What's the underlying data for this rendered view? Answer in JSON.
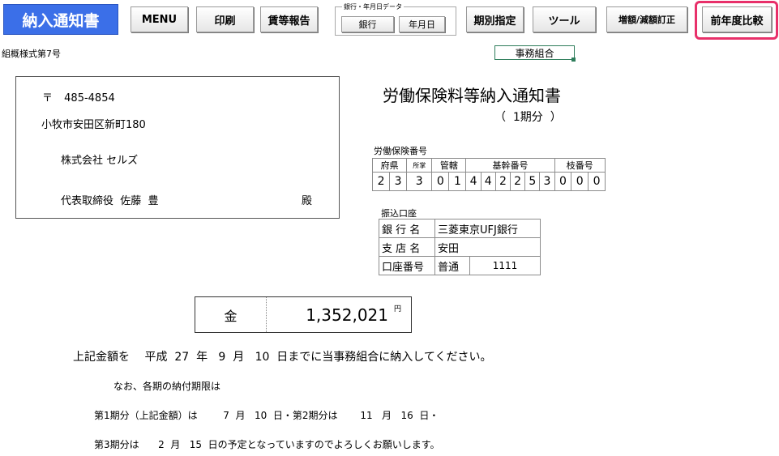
{
  "toolbar": {
    "title": "納入通知書",
    "menu": "MENU",
    "print": "印刷",
    "wage_report": "賃等報告",
    "bank_group_label": "銀行・年月日データ",
    "bank": "銀行",
    "date": "年月日",
    "period": "期別指定",
    "tool": "ツール",
    "correction": "増額/減額訂正",
    "compare": "前年度比較"
  },
  "form": {
    "form_number": "組概様式第7号",
    "association": "事務組合"
  },
  "address": {
    "postal_mark": "〒",
    "postal_code": "485-4854",
    "line1": "小牧市安田区新町180",
    "company": "株式会社 セルズ",
    "representative": "代表取締役  佐藤  豊",
    "honorific": "殿"
  },
  "document": {
    "title": "労働保険料等納入通知書",
    "period_label": "（  1期分  ）"
  },
  "insurance_number": {
    "label": "労働保険番号",
    "headers": [
      "府県",
      "所掌",
      "管轄",
      "基幹番号",
      "枝番号"
    ],
    "digits": [
      "2",
      "3",
      "3",
      "0",
      "1",
      "4",
      "4",
      "2",
      "2",
      "5",
      "3",
      "0",
      "0",
      "0"
    ]
  },
  "bank_account": {
    "label": "振込口座",
    "rows": [
      {
        "key": "銀 行 名",
        "value": "三菱東京UFJ銀行"
      },
      {
        "key": "支 店 名",
        "value": "安田"
      },
      {
        "key": "口座番号",
        "value": "普通",
        "number": "1111"
      }
    ]
  },
  "amount": {
    "label": "金",
    "value": "1,352,021",
    "unit": "円"
  },
  "body": {
    "line1": "上記金額を　 平成  27  年   9  月   10  日までに当事務組合に納入してください。",
    "line2": "なお、各期の納付期限は",
    "line3": "第1期分（上記金額）は　　  7  月   10  日・第2期分は　　 11   月   16  日・",
    "line4": "第3期分は　   2  月   15  日の予定となっていますのでよろしくお願いします。"
  }
}
